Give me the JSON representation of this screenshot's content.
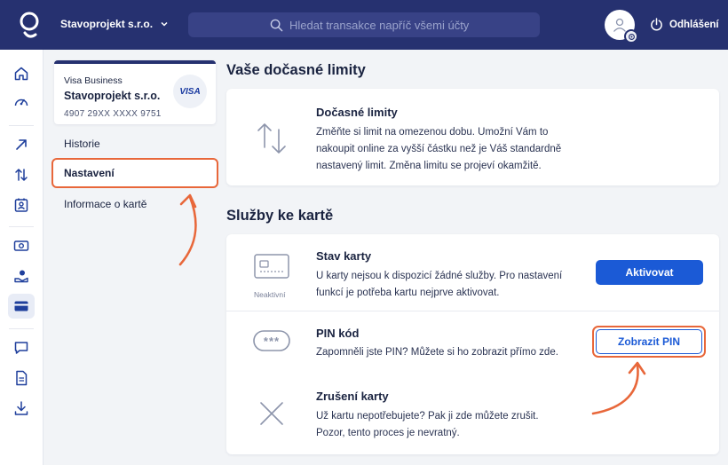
{
  "header": {
    "company": "Stavoprojekt s.r.o.",
    "search_placeholder": "Hledat transakce napříč všemi účty",
    "logout_label": "Odhlášení"
  },
  "card": {
    "type": "Visa Business",
    "holder": "Stavoprojekt s.r.o.",
    "number": "4907 29XX XXXX 9751",
    "brand": "VISA"
  },
  "side_nav": {
    "items": [
      "Historie",
      "Nastavení",
      "Informace o kartě"
    ],
    "active": "Nastavení"
  },
  "limits": {
    "section_title": "Vaše dočasné limity",
    "title": "Dočasné limity",
    "description_lines": [
      "Změňte si limit na omezenou dobu. Umožní Vám to",
      "nakoupit online za vyšší částku než je Váš standardně",
      "nastavený limit. Změna limitu se projeví okamžitě."
    ]
  },
  "services": {
    "section_title": "Služby ke kartě",
    "card_status": {
      "title": "Stav karty",
      "icon_label": "Neaktivní",
      "description_lines": [
        "U karty nejsou k dispozicí žádné služby. Pro nastavení",
        "funkcí je potřeba kartu nejprve aktivovat."
      ],
      "button": "Aktivovat"
    },
    "pin": {
      "title": "PIN kód",
      "pin_mask": "***",
      "description_lines": [
        "Zapomněli jste PIN? Můžete si ho zobrazit přímo zde."
      ],
      "button": "Zobrazit PIN"
    },
    "cancel": {
      "title": "Zrušení karty",
      "description_lines": [
        "Už kartu nepotřebujete? Pak ji zde můžete zrušit.",
        "Pozor, tento proces je nevratný."
      ]
    }
  },
  "colors": {
    "header_bg": "#263170",
    "primary": "#1b5ad6",
    "highlight": "#e8673a"
  },
  "rail_icons": [
    "home-icon",
    "dashboard-icon",
    "payment-arrow-icon",
    "transfer-icon",
    "contacts-icon",
    "cash-icon",
    "savings-icon",
    "cards-icon",
    "messages-icon",
    "documents-icon",
    "download-icon"
  ]
}
